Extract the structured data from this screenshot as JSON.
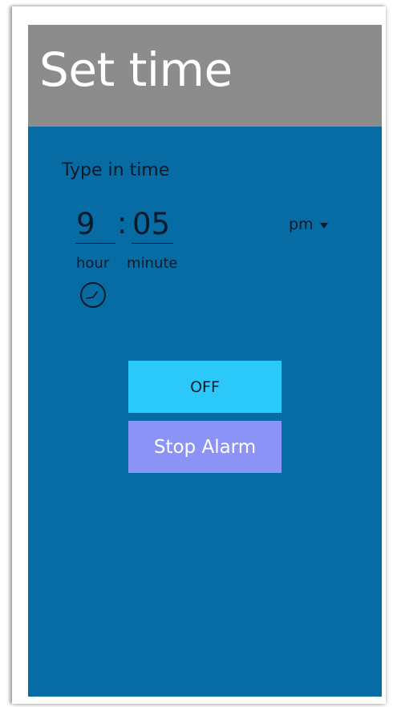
{
  "header": {
    "title": "Set time"
  },
  "form": {
    "prompt": "Type in time",
    "hour_value": "9",
    "separator": ":",
    "minute_value": "05",
    "hour_label": "hour",
    "minute_label": "minute",
    "period_selected": "pm"
  },
  "buttons": {
    "off_label": "OFF",
    "stop_label": "Stop Alarm"
  },
  "icons": {
    "clock": "clock-icon",
    "dropdown": "chevron-down-icon"
  },
  "colors": {
    "background": "#076ca4",
    "header": "#8c8c8c",
    "off_button": "#2bc8fa",
    "stop_button": "#8c93f6"
  }
}
